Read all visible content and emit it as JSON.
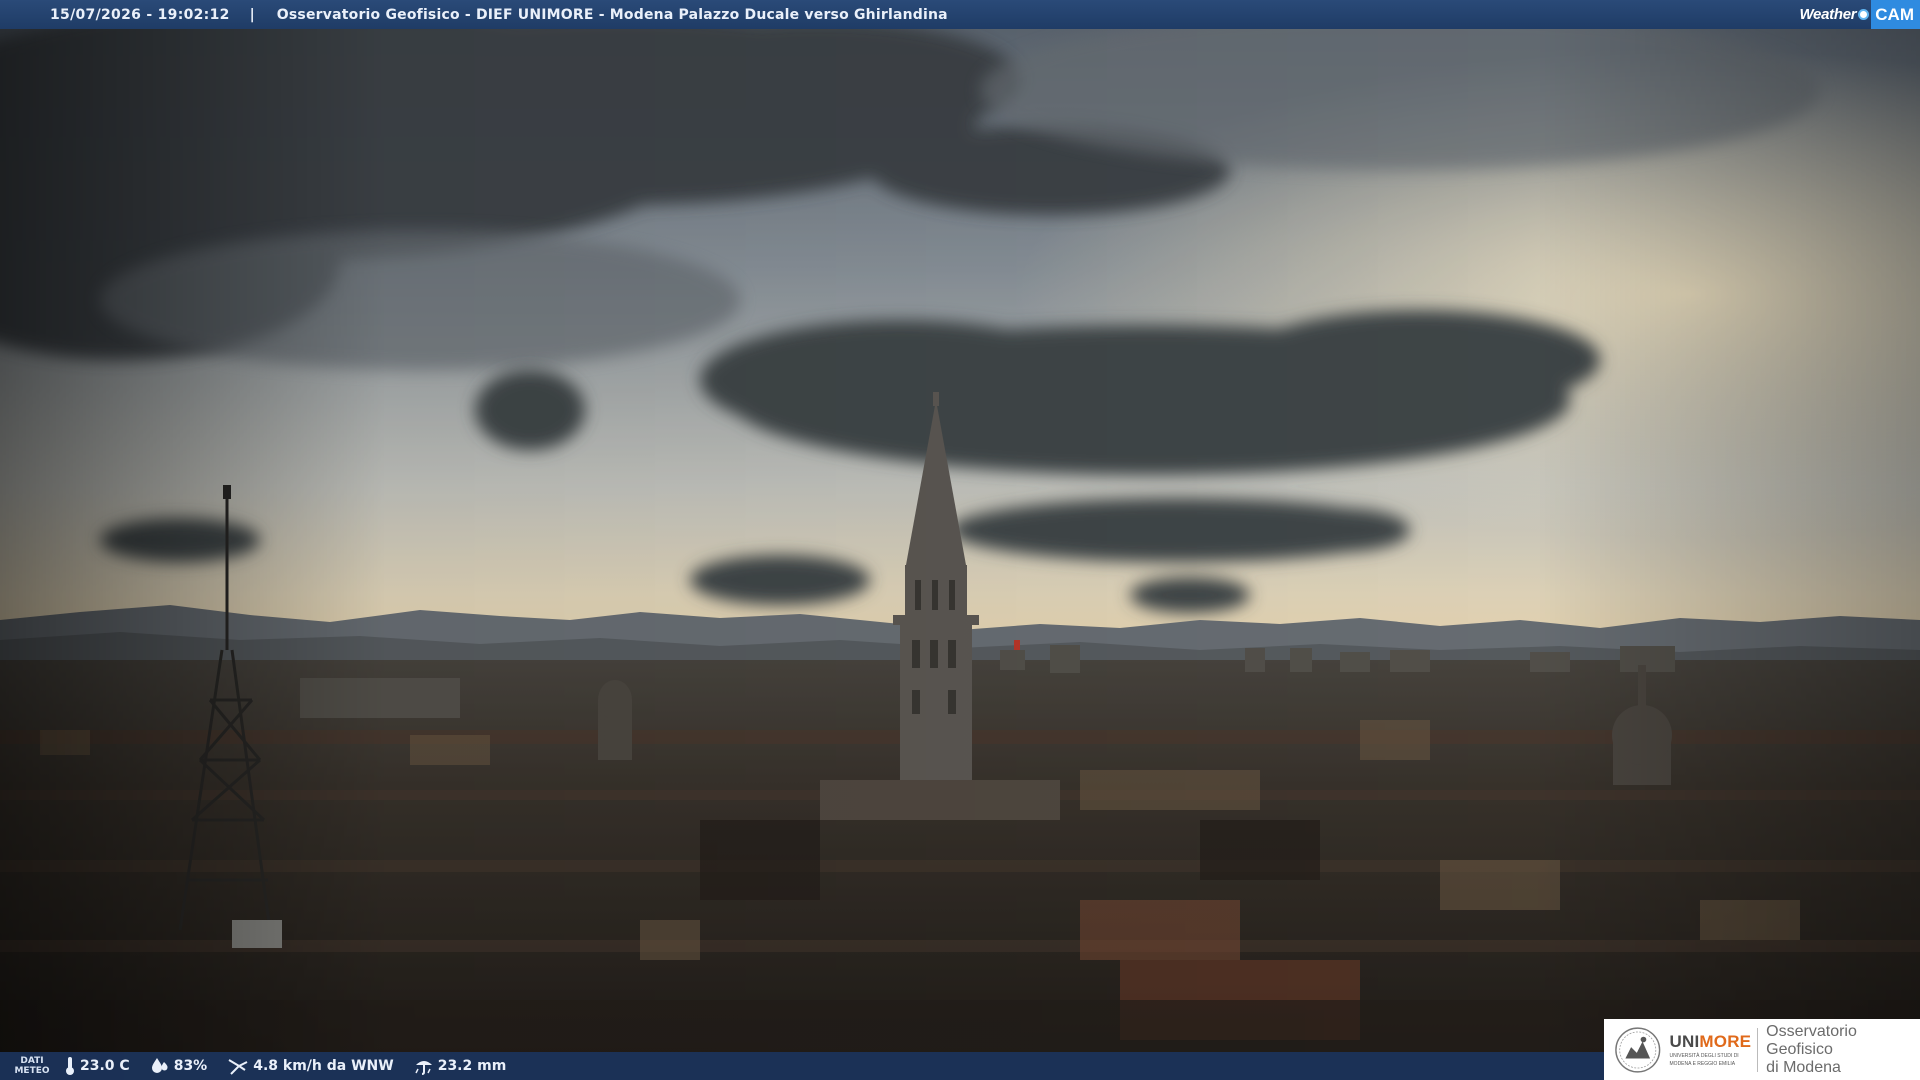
{
  "header": {
    "datetime": "15/07/2026 - 19:02:12",
    "separator": "|",
    "station": "Osservatorio Geofisico - DIEF UNIMORE - Modena Palazzo Ducale verso Ghirlandina",
    "brand_weather": "Weather",
    "brand_cam": "CAM"
  },
  "weather": {
    "label_line1": "DATI",
    "label_line2": "METEO",
    "temperature": "23.0 C",
    "humidity": "83%",
    "wind": "4.8 km/h da WNW",
    "rain": "23.2 mm",
    "icons": [
      "thermometer-icon",
      "humidity-drop-icon",
      "wind-icon",
      "rain-gauge-icon"
    ]
  },
  "logo": {
    "uni_part1": "UNI",
    "uni_part2": "MORE",
    "uni_sub_line1": "UNIVERSITÀ DEGLI STUDI DI",
    "uni_sub_line2": "MODENA E REGGIO EMILIA",
    "obs_line1": "Osservatorio Geofisico",
    "obs_line2": "di Modena"
  },
  "colors": {
    "bar_blue": "#1f3c66",
    "cam_blue": "#2f8be0",
    "unimore_orange": "#e06a1b"
  }
}
